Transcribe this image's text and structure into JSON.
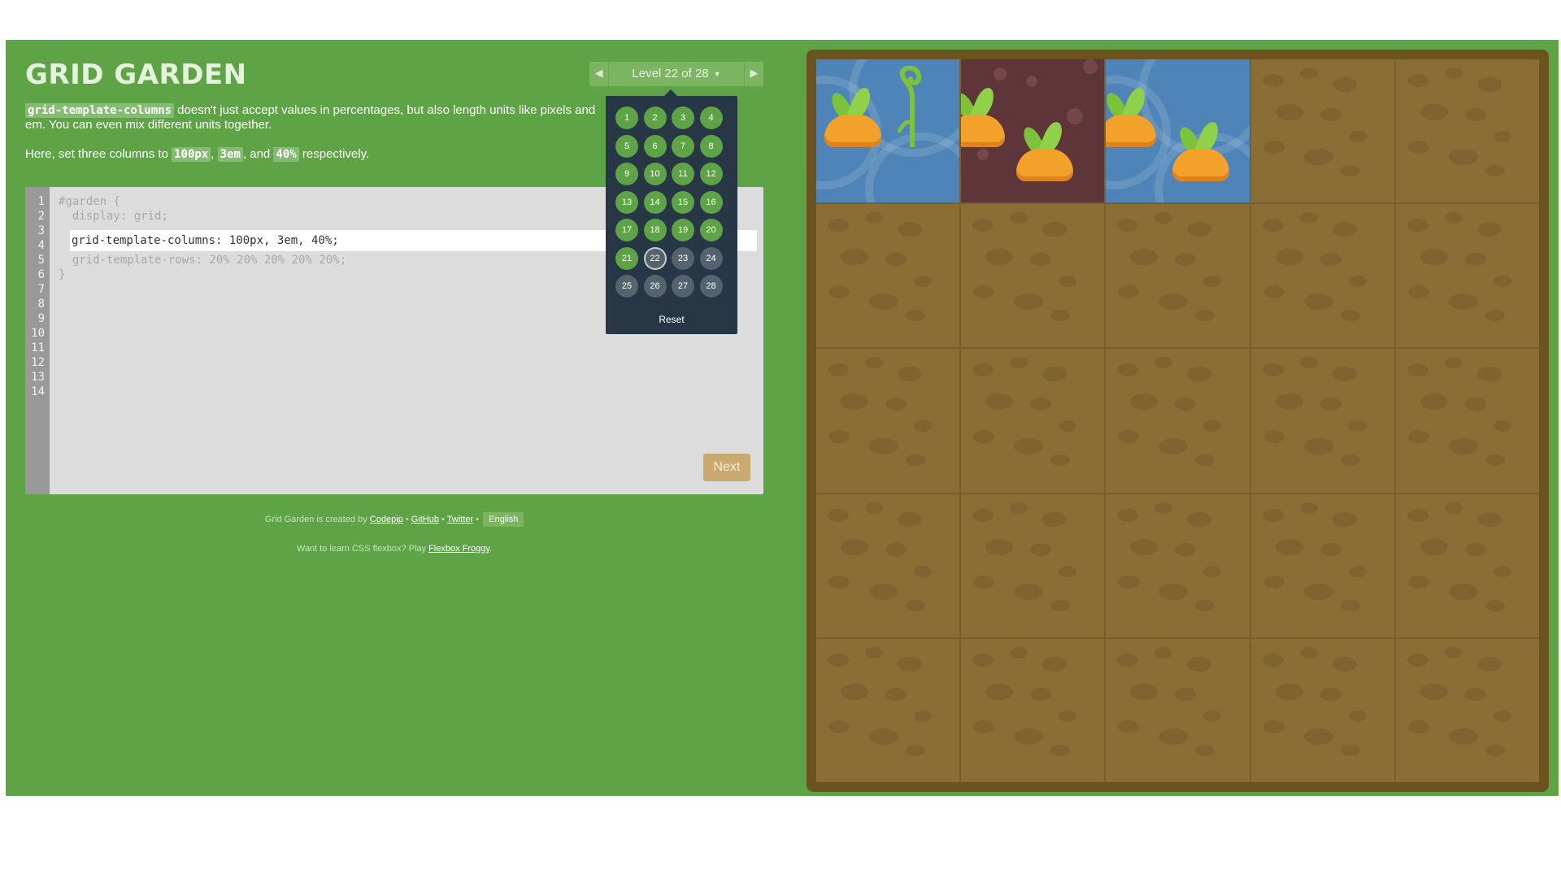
{
  "app": {
    "title": "GRID GARDEN",
    "description": {
      "code1": "grid-template-columns",
      "text1": " doesn't just accept values in percentages, but also length units like pixels and em. You can even mix different units together.",
      "text2_prefix": "Here, set three columns to ",
      "val1": "100px",
      "sep1": ", ",
      "val2": "3em",
      "sep2": ", and ",
      "val3": "40%",
      "text2_suffix": " respectively."
    }
  },
  "level_nav": {
    "prev_icon": "◀",
    "next_icon": "▶",
    "label": "Level 22 of 28",
    "caret": "▼"
  },
  "level_popup": {
    "levels": [
      {
        "n": "1",
        "state": "done"
      },
      {
        "n": "2",
        "state": "done"
      },
      {
        "n": "3",
        "state": "done"
      },
      {
        "n": "4",
        "state": "done"
      },
      {
        "n": "5",
        "state": "done"
      },
      {
        "n": "6",
        "state": "done"
      },
      {
        "n": "7",
        "state": "done"
      },
      {
        "n": "8",
        "state": "done"
      },
      {
        "n": "9",
        "state": "done"
      },
      {
        "n": "10",
        "state": "done"
      },
      {
        "n": "11",
        "state": "done"
      },
      {
        "n": "12",
        "state": "done"
      },
      {
        "n": "13",
        "state": "done"
      },
      {
        "n": "14",
        "state": "done"
      },
      {
        "n": "15",
        "state": "done"
      },
      {
        "n": "16",
        "state": "done"
      },
      {
        "n": "17",
        "state": "done"
      },
      {
        "n": "18",
        "state": "done"
      },
      {
        "n": "19",
        "state": "done"
      },
      {
        "n": "20",
        "state": "done"
      },
      {
        "n": "21",
        "state": "done"
      },
      {
        "n": "22",
        "state": "current"
      },
      {
        "n": "23",
        "state": "todo"
      },
      {
        "n": "24",
        "state": "todo"
      },
      {
        "n": "25",
        "state": "todo"
      },
      {
        "n": "26",
        "state": "todo"
      },
      {
        "n": "27",
        "state": "todo"
      },
      {
        "n": "28",
        "state": "todo"
      }
    ],
    "reset_label": "Reset"
  },
  "editor": {
    "line_numbers": [
      "1",
      "2",
      "3",
      "4",
      "5",
      "6",
      "7",
      "8",
      "9",
      "10",
      "11",
      "12",
      "13",
      "14"
    ],
    "line1": "#garden {",
    "line2": "  display: grid;",
    "input_value": "grid-template-columns: 100px, 3em, 40%;",
    "line4": "  grid-template-rows: 20% 20% 20% 20% 20%;",
    "line5": "}",
    "next_label": "Next"
  },
  "footer": {
    "created_by": "Grid Garden is created by ",
    "codepip": "Codepip",
    "bullet1": " • ",
    "github": "GitHub",
    "bullet2": " • ",
    "twitter": "Twitter",
    "bullet3": " • ",
    "language": "English",
    "flexbox_prefix": "Want to learn CSS flexbox? Play ",
    "flexbox_link": "Flexbox Froggy",
    "flexbox_suffix": "."
  },
  "colors": {
    "background": "#5ea446",
    "soil": "#8a6e35",
    "water": "#4f84b8",
    "poison": "#5e3538",
    "carrot": "#f2a22b"
  }
}
